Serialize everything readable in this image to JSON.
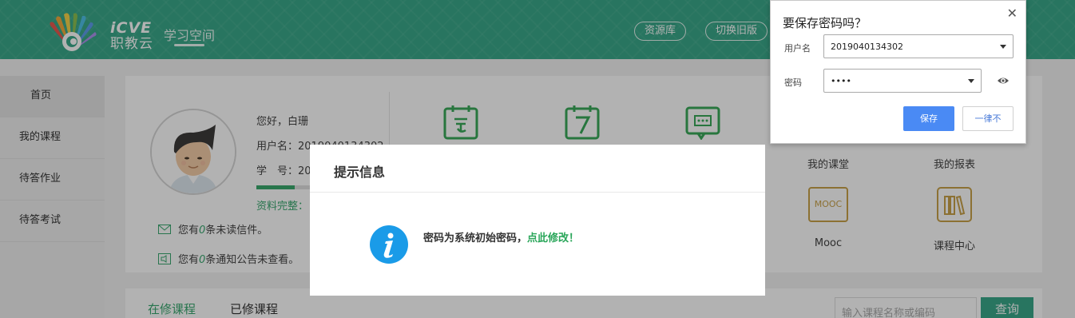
{
  "header": {
    "logo_en": "iCVE",
    "logo_cn": "职教云",
    "nav_title": "学习空间",
    "buttons": [
      "资源库",
      "切换旧版"
    ]
  },
  "sidebar": {
    "items": [
      {
        "label": "首页"
      },
      {
        "label": "我的课程"
      },
      {
        "label": "待答作业"
      },
      {
        "label": "待答考试"
      }
    ]
  },
  "profile": {
    "greeting": "您好，白珊",
    "username_line": "用户名：2019040134302",
    "student_no_line": "学　号：20",
    "completeness_label": "资料完整：",
    "completeness_fraction": 0.6,
    "unread_mail": {
      "prefix": "您有",
      "count": "0",
      "suffix": "条未读信件。"
    },
    "notices": {
      "prefix": "您有",
      "count": "0",
      "suffix": "条通知公告未查看。"
    }
  },
  "tiles": [
    {
      "label": "我的课堂",
      "icon": "classroom-icon"
    },
    {
      "label": "我的报表",
      "icon": "report-icon"
    },
    {
      "label": "Mooc",
      "icon_text": "MOOC",
      "icon": "mooc-icon"
    },
    {
      "label": "课程中心",
      "icon": "course-center-icon"
    }
  ],
  "course_tabs": {
    "tabs": [
      "在修课程",
      "已修课程"
    ],
    "search_placeholder": "输入课程名称或编码",
    "search_button": "查询"
  },
  "dialog": {
    "title": "提示信息",
    "message": "密码为系统初始密码，",
    "link": "点此修改！"
  },
  "password_popup": {
    "heading": "要保存密码吗？",
    "username_label": "用户名",
    "username_value": "2019040134302",
    "password_label": "密码",
    "password_value": "••••",
    "save_label": "保存",
    "never_label": "一律不"
  },
  "colors": {
    "brand": "#3aa88a",
    "accent_green": "#3aa870",
    "info_blue": "#1a9be8",
    "save_blue": "#4a8af4",
    "mooc_gold": "#c9a24a"
  }
}
